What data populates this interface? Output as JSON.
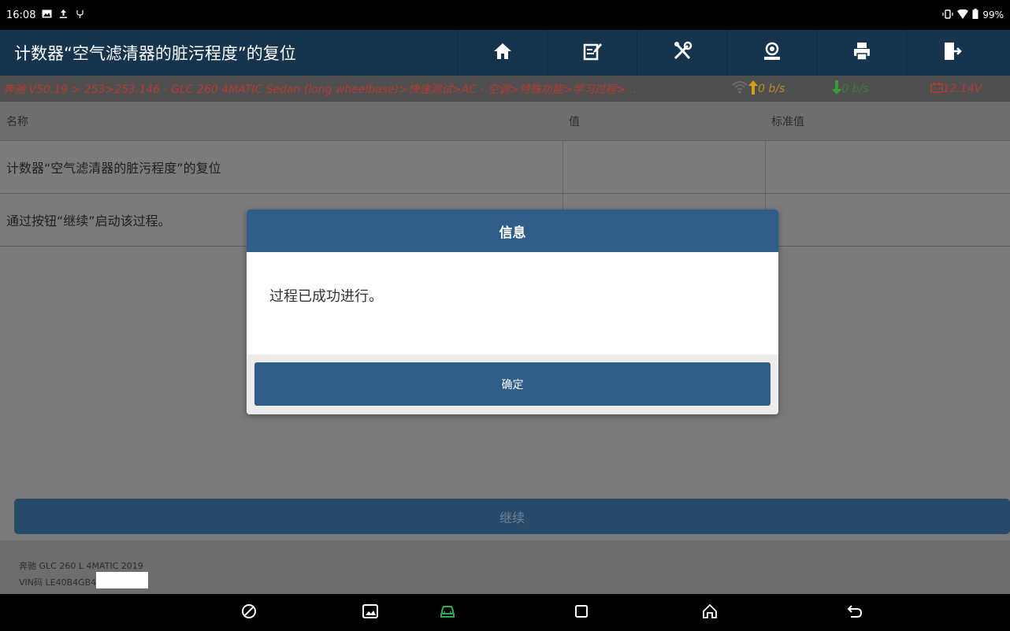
{
  "status_bar": {
    "time": "16:08",
    "battery": "99%"
  },
  "title_bar": {
    "title": "计数器“空气滤清器的脏污程度”的复位",
    "icons": [
      "home-icon",
      "edit-icon",
      "tools-icon",
      "user-icon",
      "print-icon",
      "exit-icon"
    ]
  },
  "breadcrumb": {
    "path": "奔驰 V50.19 > 253>253.146 - GLC 260 4MATIC Sedan (long wheelbase)>快速测试>AC - 空调>特殊功能>学习过程>...",
    "upload": "0 b/s",
    "download": "0 b/s",
    "voltage": "12.14V"
  },
  "table": {
    "headers": [
      "名称",
      "值",
      "标准值"
    ],
    "rows": [
      {
        "name": "计数器“空气滤清器的脏污程度”的复位",
        "value": "",
        "standard": ""
      },
      {
        "name": "通过按钮“继续”启动该过程。",
        "value": "",
        "standard": ""
      }
    ]
  },
  "continue_label": "继续",
  "footer": {
    "vehicle": "奔驰 GLC 260 L 4MATIC 2019",
    "vin": "VIN码 LE40B4GB4"
  },
  "dialog": {
    "title": "信息",
    "message": "过程已成功进行。",
    "ok_label": "确定"
  },
  "colors": {
    "title_bar": "#17344f",
    "dialog_header": "#2f5d88",
    "breadcrumb_text": "#b53b33"
  }
}
